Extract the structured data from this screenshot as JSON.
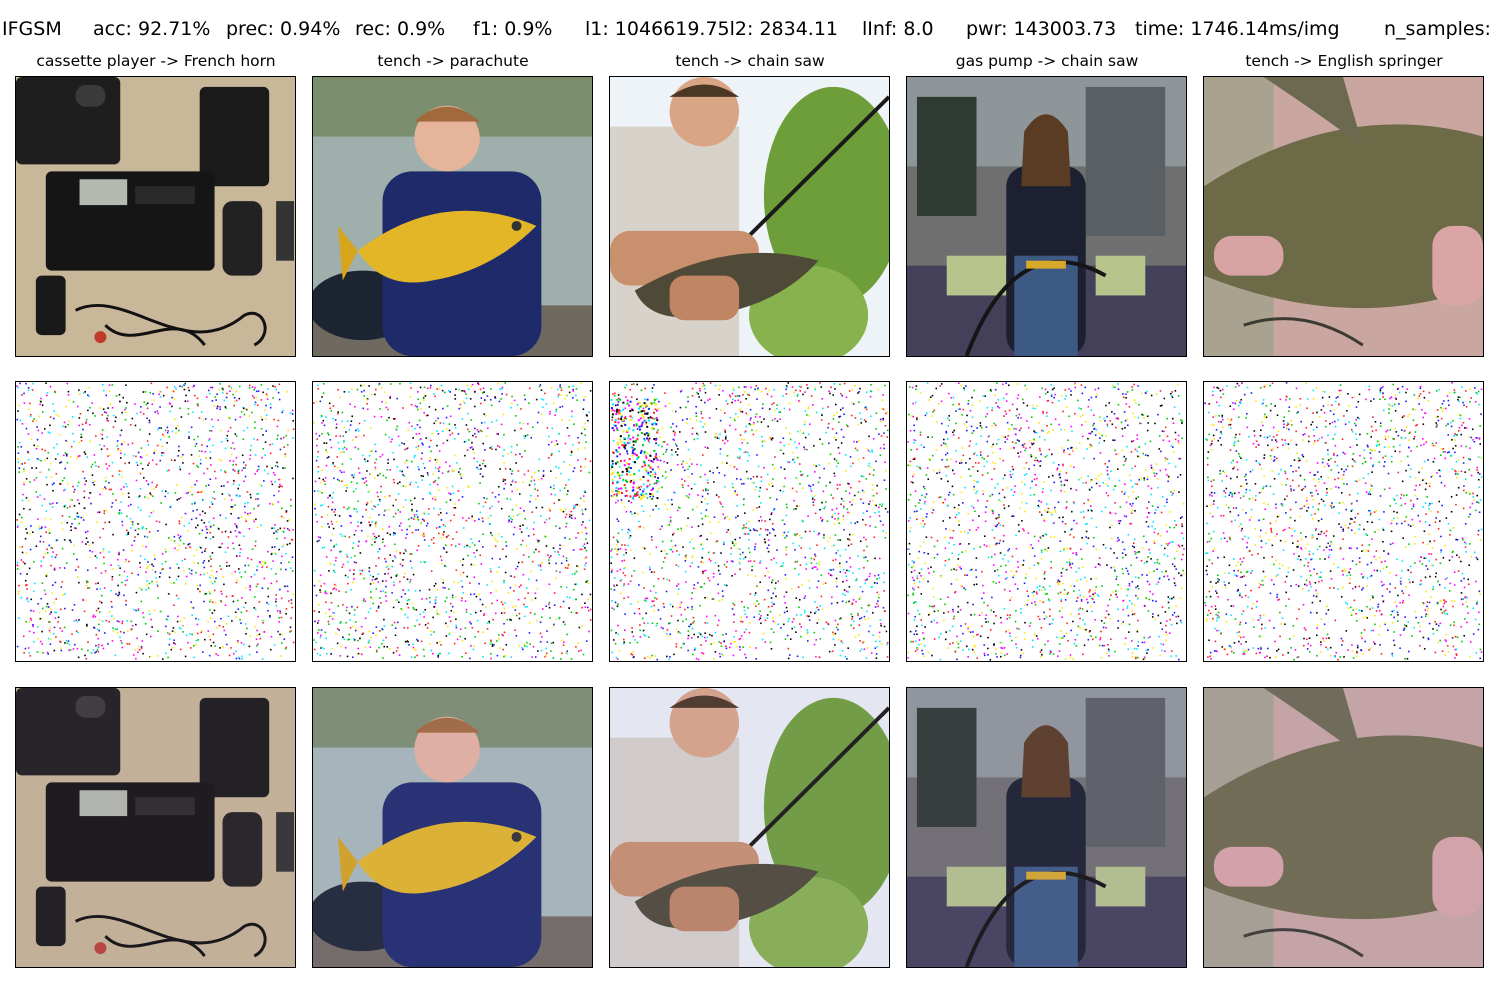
{
  "stats": {
    "method": "IFGSM",
    "acc": "acc: 92.71%",
    "prec": "prec: 0.94%",
    "rec": "rec: 0.9%",
    "f1": "f1: 0.9%",
    "l1l2": "l1: 1046619.75l2: 2834.11",
    "linf": "lInf: 8.0",
    "pwr": "pwr: 143003.73",
    "time": "time: 1746.14ms/img",
    "n_samples": "n_samples:"
  },
  "columns": [
    {
      "title": "cassette player -> French horn"
    },
    {
      "title": "tench -> parachute"
    },
    {
      "title": "tench -> chain saw"
    },
    {
      "title": "gas pump -> chain saw"
    },
    {
      "title": "tench -> English springer"
    }
  ],
  "rows": [
    "original",
    "perturbation",
    "adversarial"
  ],
  "noise_colors": [
    "#ff00ff",
    "#00e5ff",
    "#ffe500",
    "#1a1aff",
    "#00c800",
    "#ff2020",
    "#000000"
  ]
}
